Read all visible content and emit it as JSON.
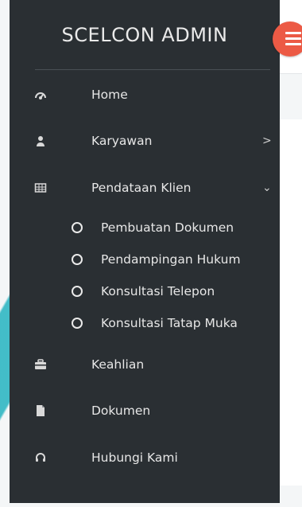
{
  "brand": {
    "title": "SCELCON ADMIN"
  },
  "menu": {
    "items": [
      {
        "label": "Home",
        "icon": "dashboard-icon"
      },
      {
        "label": "Karyawan",
        "icon": "user-icon",
        "caret": ">"
      },
      {
        "label": "Pendataan Klien",
        "icon": "table-icon",
        "caret": "⌄"
      },
      {
        "label": "Keahlian",
        "icon": "briefcase-icon"
      },
      {
        "label": "Dokumen",
        "icon": "document-icon"
      },
      {
        "label": "Hubungi Kami",
        "icon": "headset-icon"
      }
    ],
    "submenu": [
      {
        "label": "Pembuatan Dokumen"
      },
      {
        "label": "Pendampingan Hukum"
      },
      {
        "label": "Konsultasi Telepon"
      },
      {
        "label": "Konsultasi Tatap Muka"
      }
    ]
  },
  "colors": {
    "sidebar": "#2a2f33",
    "accent": "#ec5a45",
    "text": "#e7e7e7"
  }
}
